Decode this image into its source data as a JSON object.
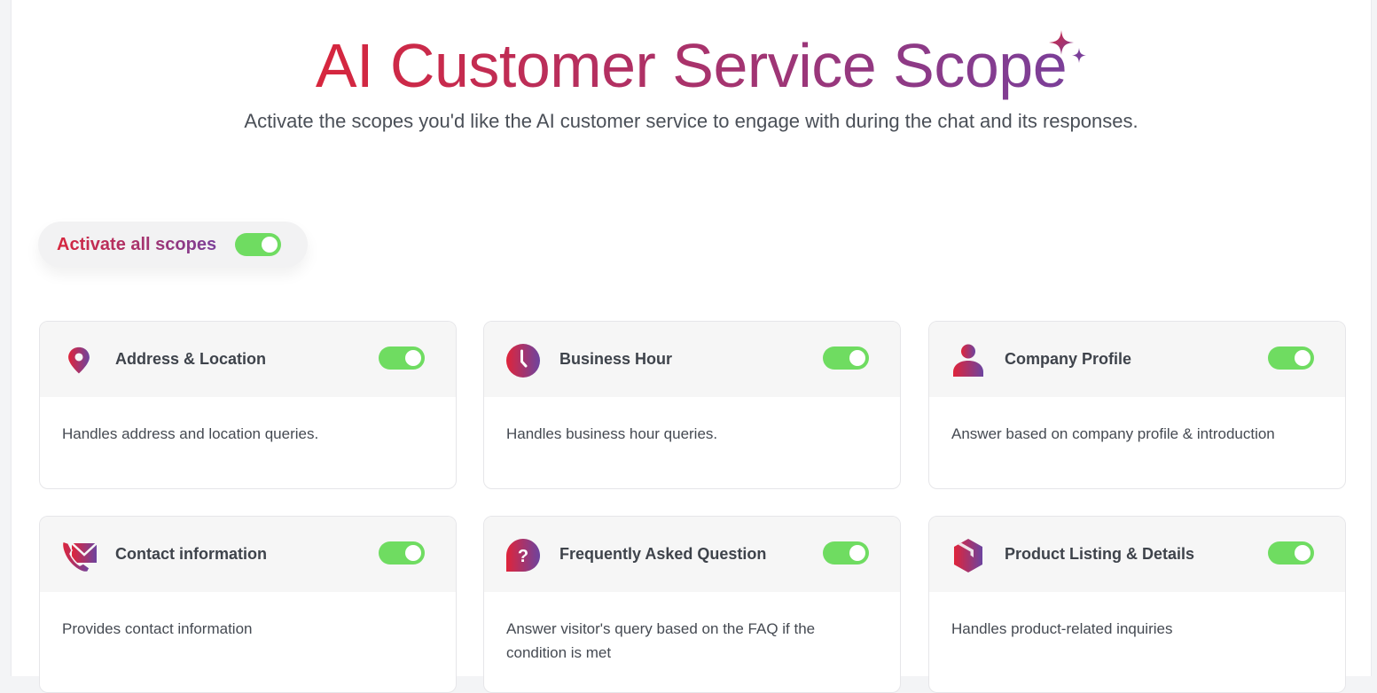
{
  "header": {
    "title": "AI Customer Service Scope",
    "title_icon": "sparkles-icon",
    "subtitle": "Activate the scopes you'd like the AI customer service to engage with during the chat and its responses."
  },
  "activate_all": {
    "label": "Activate all scopes",
    "enabled": true
  },
  "colors": {
    "gradient_start": "#d7263d",
    "gradient_end": "#7b3f99",
    "toggle_on": "#6fdc61",
    "card_header_bg": "#f6f6f6",
    "text_dark": "#3e434b"
  },
  "scopes": [
    {
      "title": "Address & Location",
      "icon": "location-pin-icon",
      "description": "Handles address and location queries.",
      "enabled": true
    },
    {
      "title": "Business Hour",
      "icon": "clock-icon",
      "description": "Handles business hour queries.",
      "enabled": true
    },
    {
      "title": "Company Profile",
      "icon": "user-profile-icon",
      "description": "Answer based on company profile & introduction",
      "enabled": true
    },
    {
      "title": "Contact information",
      "icon": "phone-envelope-icon",
      "description": "Provides contact information",
      "enabled": true
    },
    {
      "title": "Frequently Asked Question",
      "icon": "question-bubble-icon",
      "description": "Answer visitor's query based on the FAQ if the condition is met",
      "enabled": true
    },
    {
      "title": "Product Listing & Details",
      "icon": "product-box-icon",
      "description": "Handles product-related inquiries",
      "enabled": true
    }
  ]
}
